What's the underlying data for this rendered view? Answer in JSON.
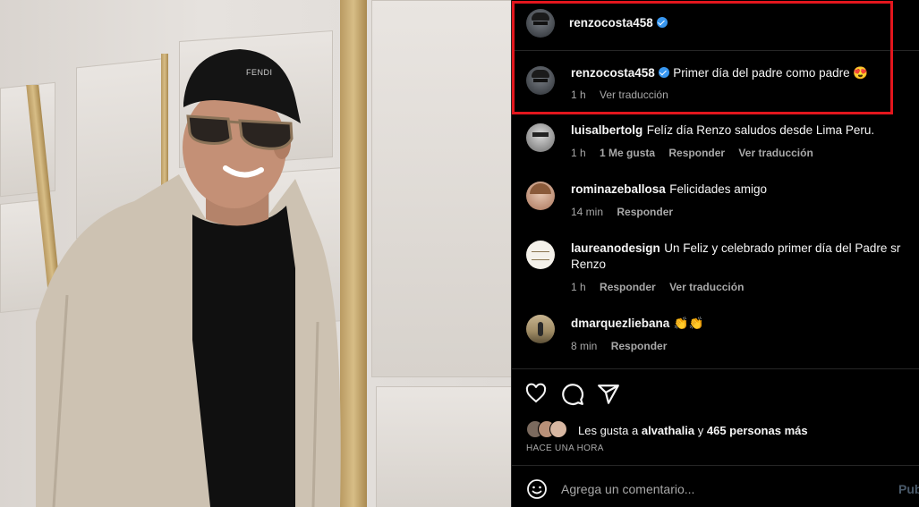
{
  "post": {
    "author": "renzocosta458",
    "caption_author": "renzocosta458",
    "caption": "Primer día del padre como padre 😍",
    "caption_time": "1 h",
    "caption_translate": "Ver traducción",
    "cap_logo": "FENDI"
  },
  "comments": [
    {
      "user": "luisalbertolg",
      "text": "Felíz día Renzo saludos desde Lima Peru.",
      "time": "1 h",
      "likes": "1 Me gusta",
      "reply": "Responder",
      "translate": "Ver traducción"
    },
    {
      "user": "rominazeballosa",
      "text": "Felicidades amigo",
      "time": "14 min",
      "reply": "Responder"
    },
    {
      "user": "laureanodesign",
      "text": "Un Feliz y celebrado primer día del Padre sr Renzo",
      "time": "1 h",
      "reply": "Responder",
      "translate": "Ver traducción"
    },
    {
      "user": "dmarquezliebana",
      "text": "👏👏",
      "time": "8 min",
      "reply": "Responder"
    }
  ],
  "likes": {
    "prefix": "Les gusta a",
    "user": "alvathalia",
    "mid": "y",
    "rest": "465 personas más",
    "timestamp": "HACE UNA HORA"
  },
  "composer": {
    "placeholder": "Agrega un comentario...",
    "publish": "Publicar"
  },
  "icons": [
    "heart-icon",
    "comment-icon",
    "share-icon",
    "emoji-icon",
    "verified-icon"
  ],
  "colors": {
    "highlight": "#e3161d",
    "verified": "#3897f0",
    "background": "#000000"
  }
}
